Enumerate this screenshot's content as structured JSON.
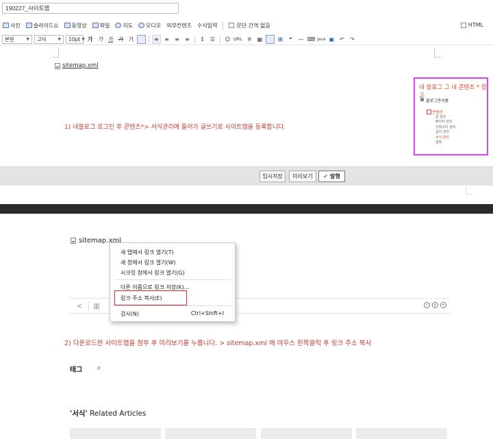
{
  "editor": {
    "title_value": "190227_사이트맵",
    "toolbar_insert": [
      {
        "label": "사진",
        "icon": "photo-icon"
      },
      {
        "label": "슬라이드쇼",
        "icon": "slideshow-icon"
      },
      {
        "label": "동영상",
        "icon": "video-icon"
      },
      {
        "label": "파일",
        "icon": "file-icon"
      },
      {
        "label": "지도",
        "icon": "map-icon"
      },
      {
        "label": "오디오",
        "icon": "audio-icon"
      },
      {
        "label": "외부컨텐츠",
        "icon": ""
      },
      {
        "label": "수식입력",
        "icon": ""
      }
    ],
    "paragraph_spacing_label": "문단 간격 없음",
    "html_label": "HTML",
    "format": {
      "style_select": "본문",
      "font_select": "고딕",
      "size_select": "10pt",
      "url_label": "URL"
    },
    "attached_file": "sitemap.xml",
    "step1_text": "1) 내블로그 로그인 후 콘텐츠*> 서식관리에 들어가 글쓰기로 사이트맵을 등록합니다.",
    "blog_menu": {
      "title": "내 블로그 그 내 콘텐츠 * 참고",
      "home": "블로그관리홈",
      "section": "콘텐츠",
      "items": [
        "글 관리",
        "페이지 관리",
        "카테고리 관리",
        "공지 관리",
        "서식 관리",
        "설정"
      ],
      "highlight_index": 4
    },
    "buttons": {
      "save": "임시저장",
      "preview": "미리보기",
      "publish": "발행"
    }
  },
  "view": {
    "attached_file": "sitemap.xml",
    "context_menu": {
      "items": [
        {
          "label": "새 탭에서 링크 열기(T)",
          "shortcut": ""
        },
        {
          "label": "새 창에서 링크 열기(W)",
          "shortcut": ""
        },
        {
          "label": "시크릿 창에서 링크 열기(G)",
          "shortcut": ""
        },
        {
          "label": "다른 이름으로 링크 저장(K)...",
          "shortcut": ""
        },
        {
          "label": "링크 주소 복사(E)",
          "shortcut": ""
        },
        {
          "label": "검사(N)",
          "shortcut": "Ctrl+Shift+I"
        }
      ],
      "highlighted_index": 4
    },
    "step2_text": "2) 다운로드한 사이트맵을 첨부 후 미리보기를 누릅니다. > sitemap.xml 에 마우스 왼쪽클릭 후 링크 주소 복사",
    "tag_label": "태그",
    "tag_hash": "#",
    "related_prefix": "'서식'",
    "related_suffix": " Related Articles"
  },
  "colors": {
    "highlight_border": "#e040fb",
    "instruction_text": "#c0392b",
    "red_box": "#d8262c"
  }
}
